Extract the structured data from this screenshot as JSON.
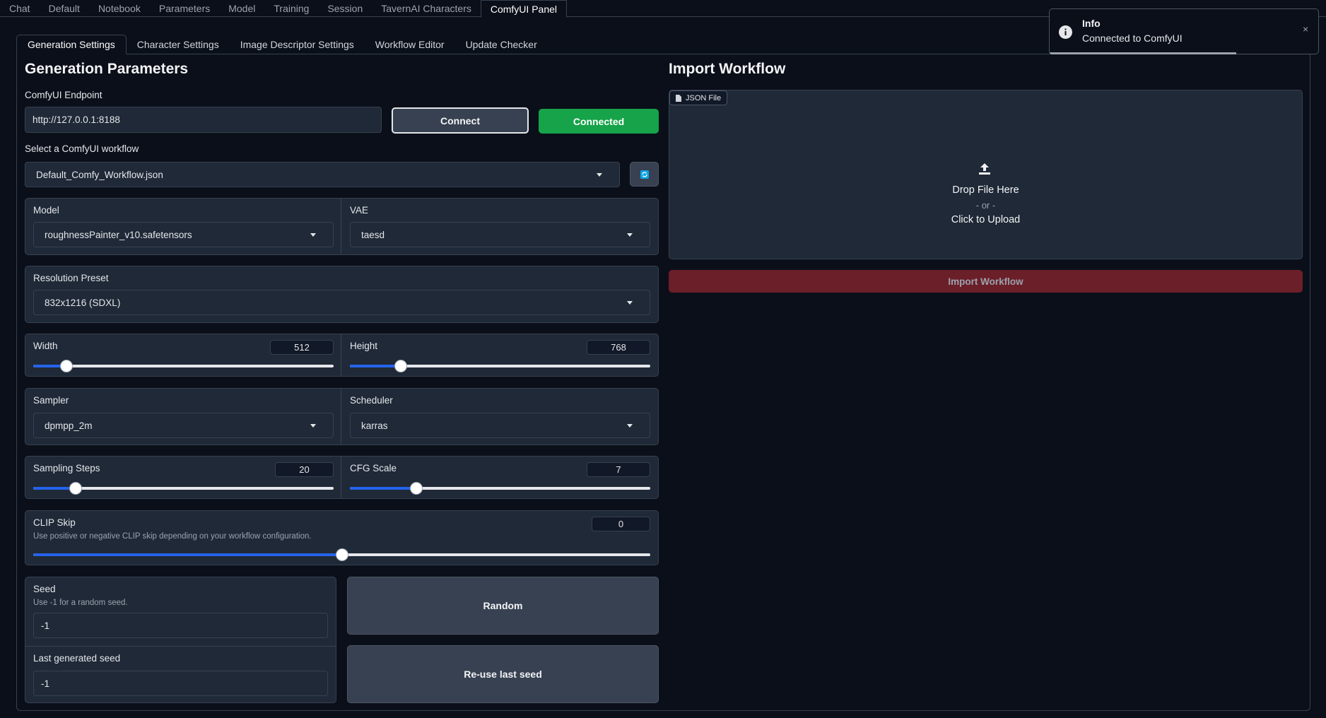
{
  "top_tabs": [
    "Chat",
    "Default",
    "Notebook",
    "Parameters",
    "Model",
    "Training",
    "Session",
    "TavernAI Characters",
    "ComfyUI Panel"
  ],
  "sub_tabs": [
    "Generation Settings",
    "Character Settings",
    "Image Descriptor Settings",
    "Workflow Editor",
    "Update Checker"
  ],
  "left": {
    "title": "Generation Parameters",
    "endpoint_label": "ComfyUI Endpoint",
    "endpoint_value": "http://127.0.0.1:8188",
    "connect_label": "Connect",
    "status_label": "Connected",
    "workflow_label": "Select a ComfyUI workflow",
    "workflow_value": "Default_Comfy_Workflow.json",
    "refresh_icon": "refresh-icon",
    "model_label": "Model",
    "model_value": "roughnessPainter_v10.safetensors",
    "vae_label": "VAE",
    "vae_value": "taesd",
    "resolution_label": "Resolution Preset",
    "resolution_value": "832x1216 (SDXL)",
    "width_label": "Width",
    "width_value": "512",
    "width_level": 0.11,
    "height_label": "Height",
    "height_value": "768",
    "height_level": 0.17,
    "sampler_label": "Sampler",
    "sampler_value": "dpmpp_2m",
    "scheduler_label": "Scheduler",
    "scheduler_value": "karras",
    "steps_label": "Sampling Steps",
    "steps_value": "20",
    "steps_level": 0.14,
    "cfg_label": "CFG Scale",
    "cfg_value": "7",
    "cfg_level": 0.22,
    "clip_label": "CLIP Skip",
    "clip_help": "Use positive or negative CLIP skip depending on your workflow configuration.",
    "clip_value": "0",
    "clip_level": 0.5,
    "seed_label": "Seed",
    "seed_help": "Use -1 for a random seed.",
    "seed_value": "-1",
    "last_seed_label": "Last generated seed",
    "last_seed_value": "-1",
    "random_label": "Random",
    "reuse_label": "Re-use last seed"
  },
  "right": {
    "title": "Import Workflow",
    "file_badge": "JSON File",
    "drop_text": "Drop File Here",
    "or_text": "- or -",
    "click_text": "Click to Upload",
    "import_label": "Import Workflow"
  },
  "toast": {
    "title": "Info",
    "message": "Connected to ComfyUI",
    "close": "×"
  },
  "colors": {
    "accent": "#2563eb",
    "connected_green": "#16a34a",
    "import_red": "#7f1d1d"
  }
}
